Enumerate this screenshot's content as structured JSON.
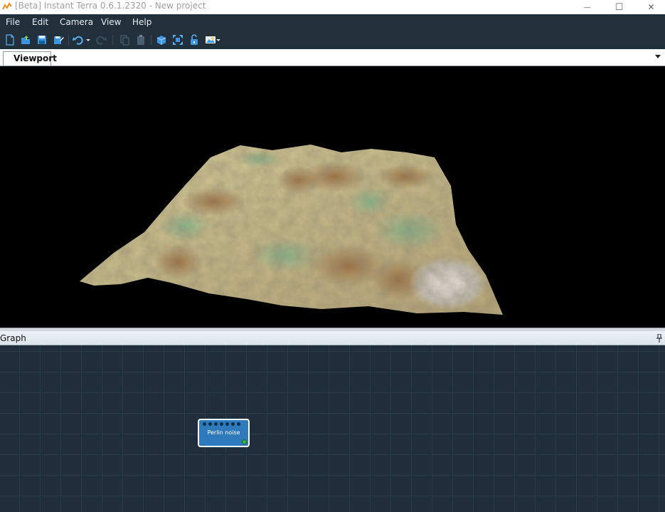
{
  "window": {
    "title": "[Beta] Instant Terra 0.6.1.2320 - New project",
    "minimize_glyph": "—",
    "maximize_glyph": "☐",
    "close_glyph": "✕"
  },
  "menu": {
    "items": [
      {
        "label": "File"
      },
      {
        "label": "Edit"
      },
      {
        "label": "Camera"
      },
      {
        "label": "View"
      },
      {
        "label": "Help"
      }
    ]
  },
  "toolbar": {
    "icons": [
      "new-file-icon",
      "open-file-icon",
      "save-icon",
      "save-as-icon",
      "undo-icon",
      "undo-dropdown-icon",
      "redo-icon",
      "copy-icon",
      "paste-icon",
      "cube-view-icon",
      "fit-view-icon",
      "unlock-icon",
      "screenshot-icon",
      "screenshot-dropdown-icon"
    ]
  },
  "tabs": {
    "viewport_label": "Viewport"
  },
  "graph": {
    "panel_title": "Graph",
    "nodes": [
      {
        "title": "Perlin noise"
      }
    ]
  },
  "colors": {
    "accent_node": "#2e7abd",
    "output_port": "#39b54a",
    "menu_bg": "#22303c",
    "graph_bg": "#1f2e3a"
  }
}
